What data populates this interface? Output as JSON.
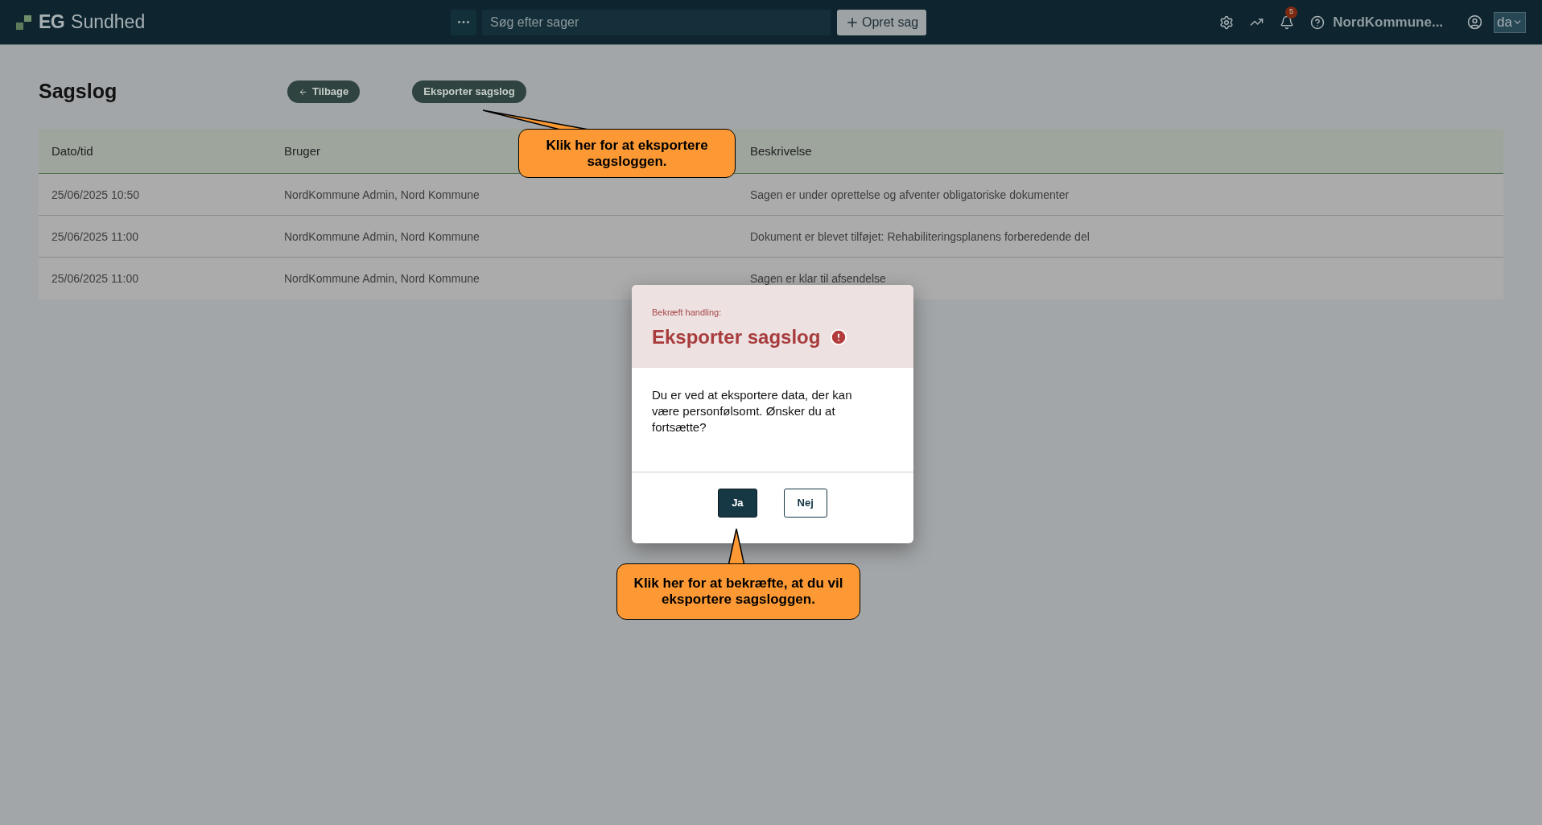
{
  "header": {
    "logo_mark": "EG",
    "brand": "Sundhed",
    "search": {
      "placeholder": "Søg efter sager"
    },
    "create_button": "Opret sag",
    "notification_count": "5",
    "user": "NordKommune...",
    "language": "da"
  },
  "page": {
    "title": "Sagslog",
    "back_button": "Tilbage",
    "export_button": "Eksporter sagslog"
  },
  "table": {
    "columns": [
      "Dato/tid",
      "Bruger",
      "Beskrivelse"
    ],
    "rows": [
      [
        "25/06/2025 10:50",
        "NordKommune Admin, Nord Kommune",
        "Sagen er under oprettelse og afventer obligatoriske dokumenter"
      ],
      [
        "25/06/2025 11:00",
        "NordKommune Admin, Nord Kommune",
        "Dokument er blevet tilføjet: Rehabiliteringsplanens forberedende del"
      ],
      [
        "25/06/2025 11:00",
        "NordKommune Admin, Nord Kommune",
        "Sagen er klar til afsendelse"
      ]
    ]
  },
  "dialog": {
    "subtitle": "Bekræft handling:",
    "title": "Eksporter sagslog",
    "message": "Du er ved at eksportere data, der kan være personfølsomt. Ønsker du at fortsætte?",
    "buttons": [
      {
        "label": "Ja",
        "kind": "primary"
      },
      {
        "label": "Nej",
        "kind": "secondary"
      }
    ]
  },
  "callouts": [
    {
      "text": "Klik her for at eksportere sagsloggen.",
      "kind": "export"
    },
    {
      "text": "Klik her for at bekræfte, at du vil eksportere sagsloggen.",
      "kind": "confirm"
    }
  ]
}
